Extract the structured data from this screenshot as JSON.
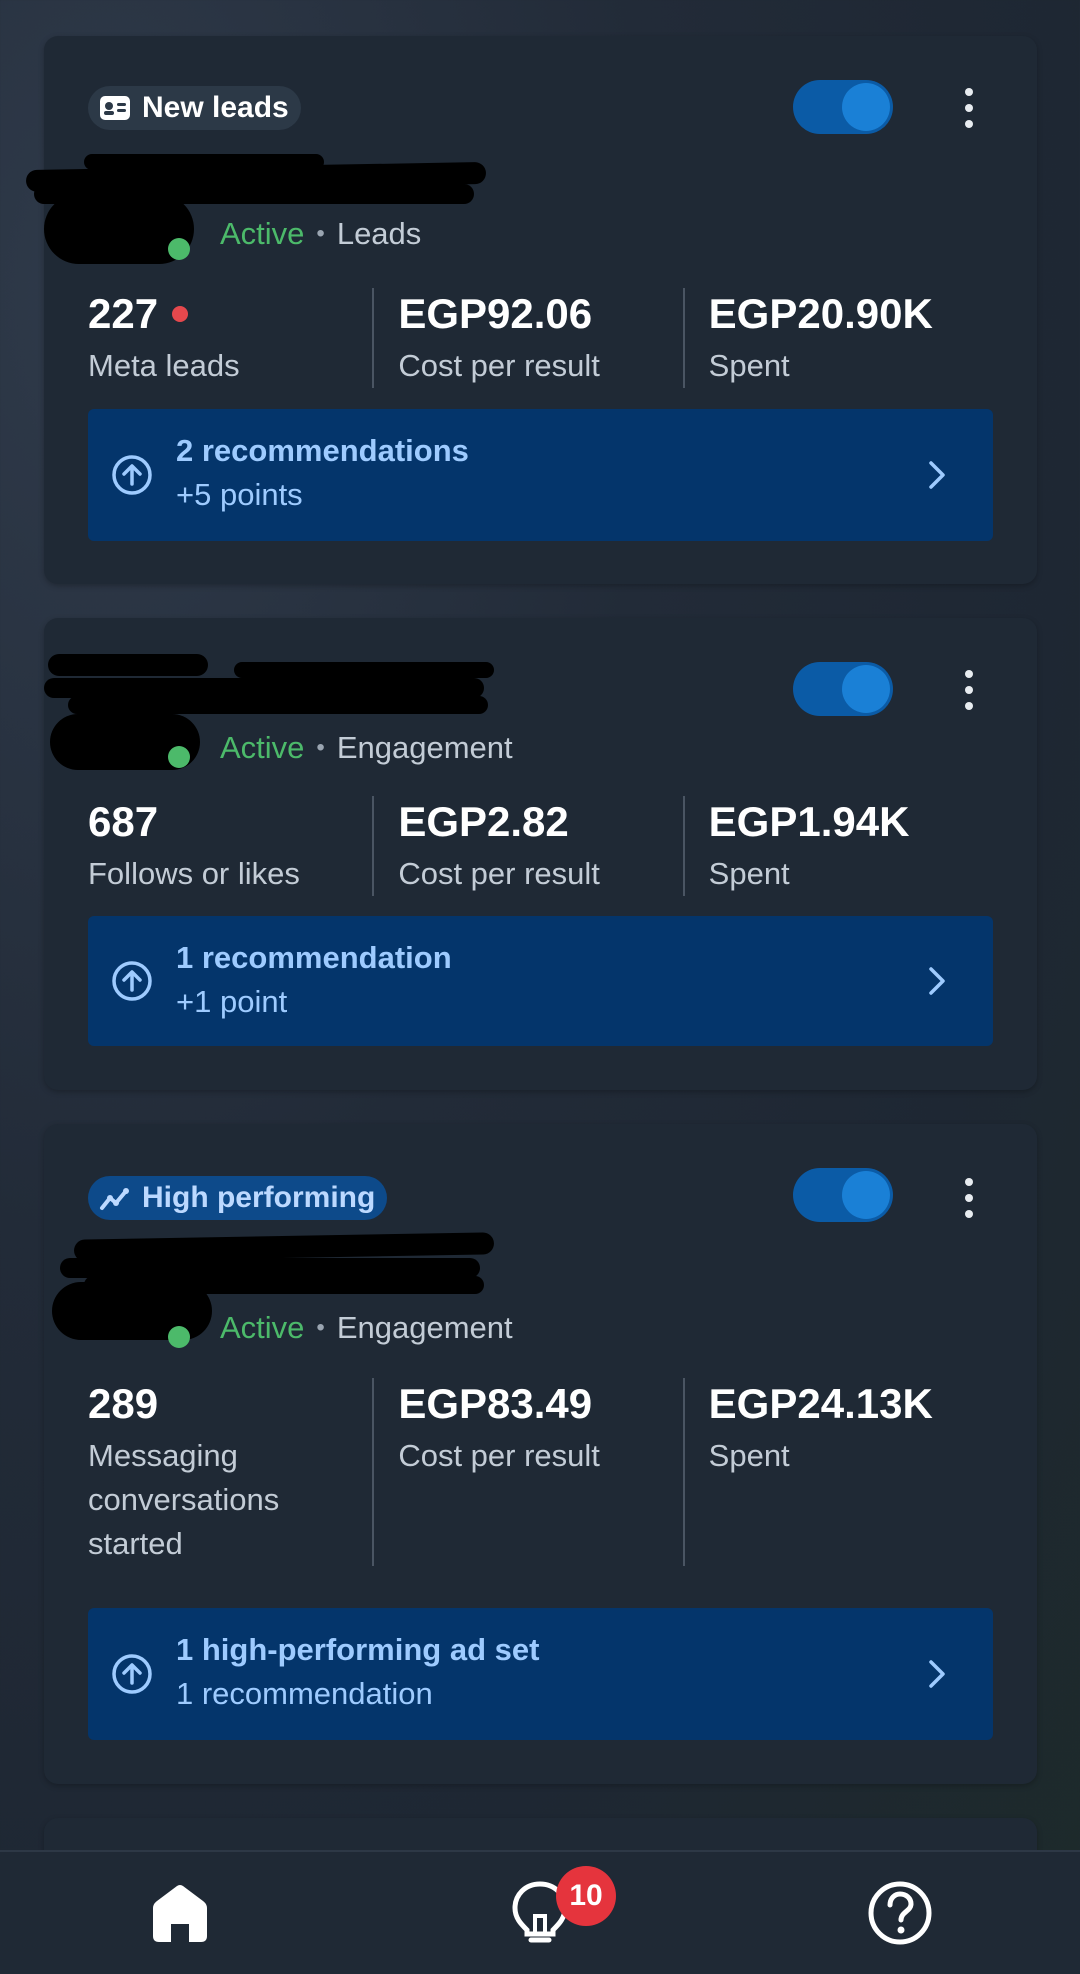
{
  "cards": [
    {
      "tag": "New leads",
      "status": "Active",
      "objective": "Leads",
      "metrics": [
        {
          "value": "227",
          "label": "Meta leads",
          "alert": true
        },
        {
          "value": "EGP92.06",
          "label": "Cost per result"
        },
        {
          "value": "EGP20.90K",
          "label": "Spent"
        }
      ],
      "reco": {
        "line1": "2 recommendations",
        "line2": "+5 points"
      }
    },
    {
      "status": "Active",
      "objective": "Engagement",
      "metrics": [
        {
          "value": "687",
          "label": "Follows or likes"
        },
        {
          "value": "EGP2.82",
          "label": "Cost per result"
        },
        {
          "value": "EGP1.94K",
          "label": "Spent"
        }
      ],
      "reco": {
        "line1": "1 recommendation",
        "line2": "+1 point"
      }
    },
    {
      "tag": "High performing",
      "status": "Active",
      "objective": "Engagement",
      "metrics": [
        {
          "value": "289",
          "label": "Messaging conversations started"
        },
        {
          "value": "EGP83.49",
          "label": "Cost per result"
        },
        {
          "value": "EGP24.13K",
          "label": "Spent"
        }
      ],
      "reco": {
        "line1": "1 high-performing ad set",
        "line2": "1 recommendation"
      }
    }
  ],
  "bottom_nav": {
    "items": [
      {
        "icon": "home-icon"
      },
      {
        "icon": "lightbulb-icon",
        "badge": "10"
      },
      {
        "icon": "help-icon"
      }
    ]
  },
  "colors": {
    "active_green": "#4cba6a",
    "recommendation_bg": "#04356b",
    "toggle_on": "#1a80d6",
    "badge_red": "#e5343d"
  }
}
